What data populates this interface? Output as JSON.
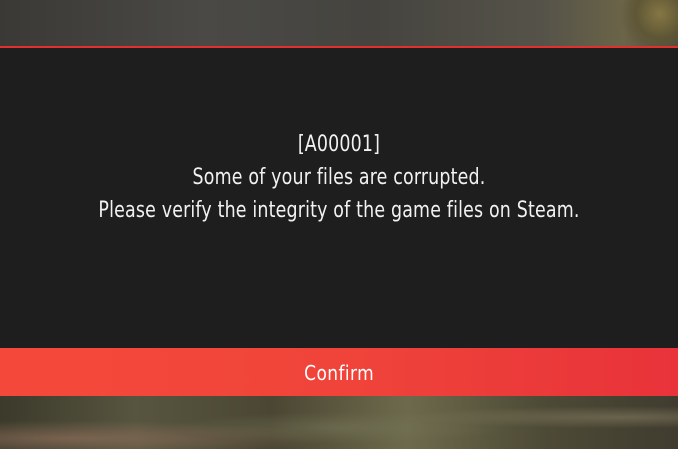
{
  "error_dialog": {
    "error_code": "[A00001]",
    "message_line_1": "Some of your files are corrupted.",
    "message_line_2": "Please verify the integrity of the game files on Steam.",
    "confirm_label": "Confirm"
  },
  "colors": {
    "modal_background": "#1e1e1e",
    "accent_red": "#f0443a",
    "text": "#f2f2f2"
  }
}
